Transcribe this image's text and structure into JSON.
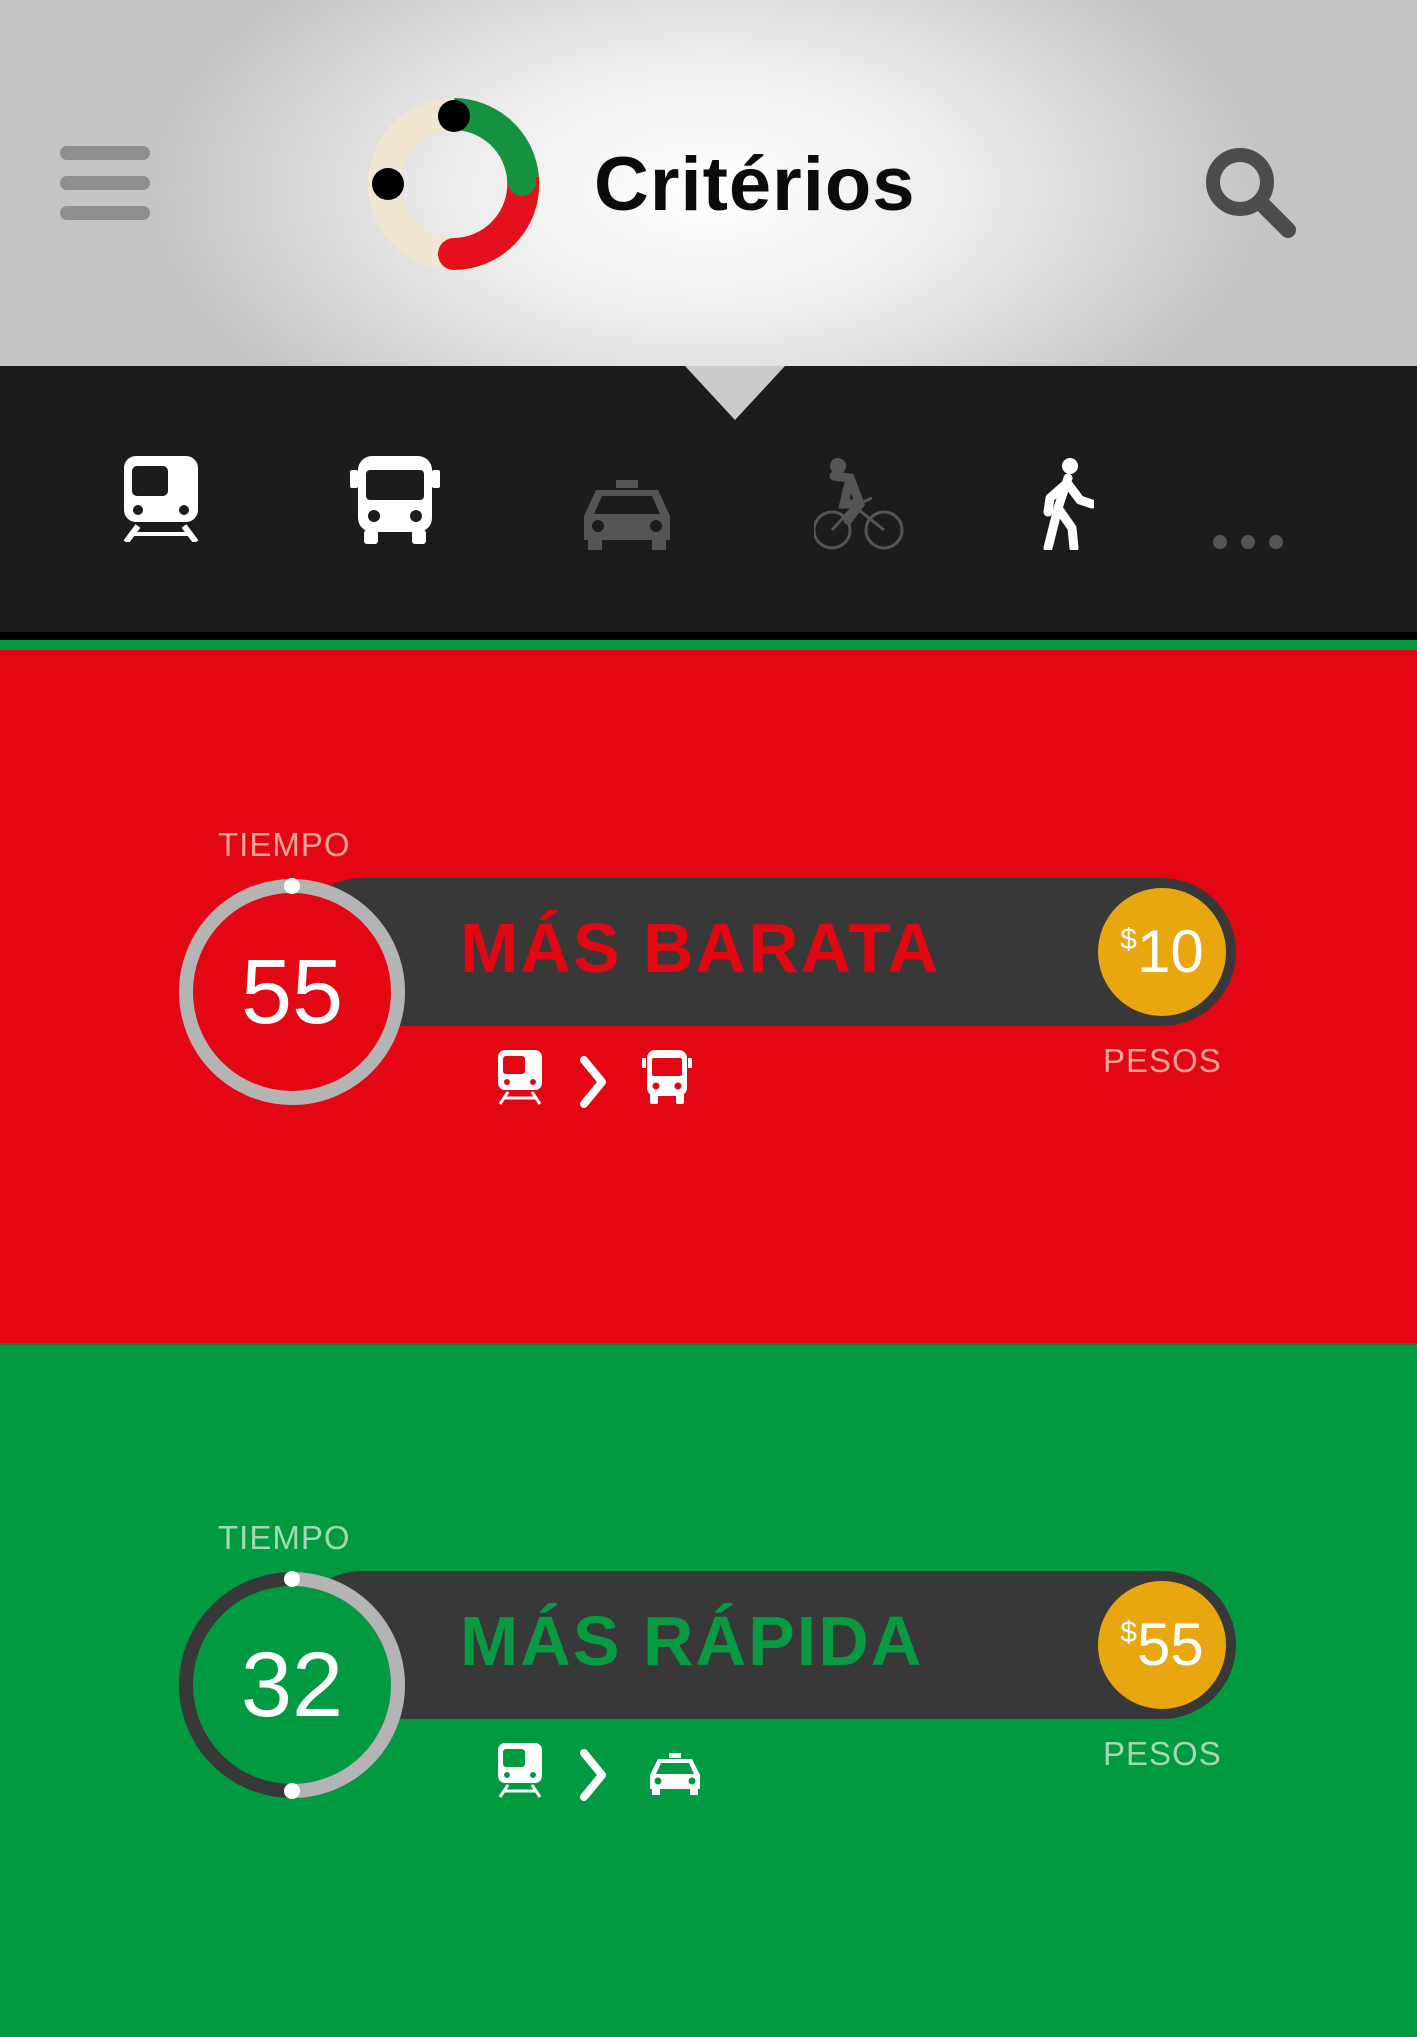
{
  "header": {
    "title": "Critérios"
  },
  "modes": [
    {
      "name": "metro",
      "active": true
    },
    {
      "name": "bus",
      "active": true
    },
    {
      "name": "taxi",
      "active": false
    },
    {
      "name": "bicycle",
      "active": false
    },
    {
      "name": "walk",
      "active": true
    },
    {
      "name": "more",
      "active": true
    }
  ],
  "routes": [
    {
      "tiempo_label": "TIEMPO",
      "minutes": "55",
      "time_fraction": 1.0,
      "title": "MÁS BARATA",
      "currency": "$",
      "price": "10",
      "price_label": "PESOS",
      "legs": [
        "metro-icon",
        "bus-icon"
      ]
    },
    {
      "tiempo_label": "TIEMPO",
      "minutes": "32",
      "time_fraction": 0.5,
      "title": "MÁS RÁPIDA",
      "currency": "$",
      "price": "55",
      "price_label": "PESOS",
      "legs": [
        "metro-icon",
        "taxi-icon"
      ]
    }
  ],
  "colors": {
    "cheap": "#e30613",
    "fast": "#029a41",
    "price_badge": "#e8a70e",
    "bar": "#383838"
  }
}
